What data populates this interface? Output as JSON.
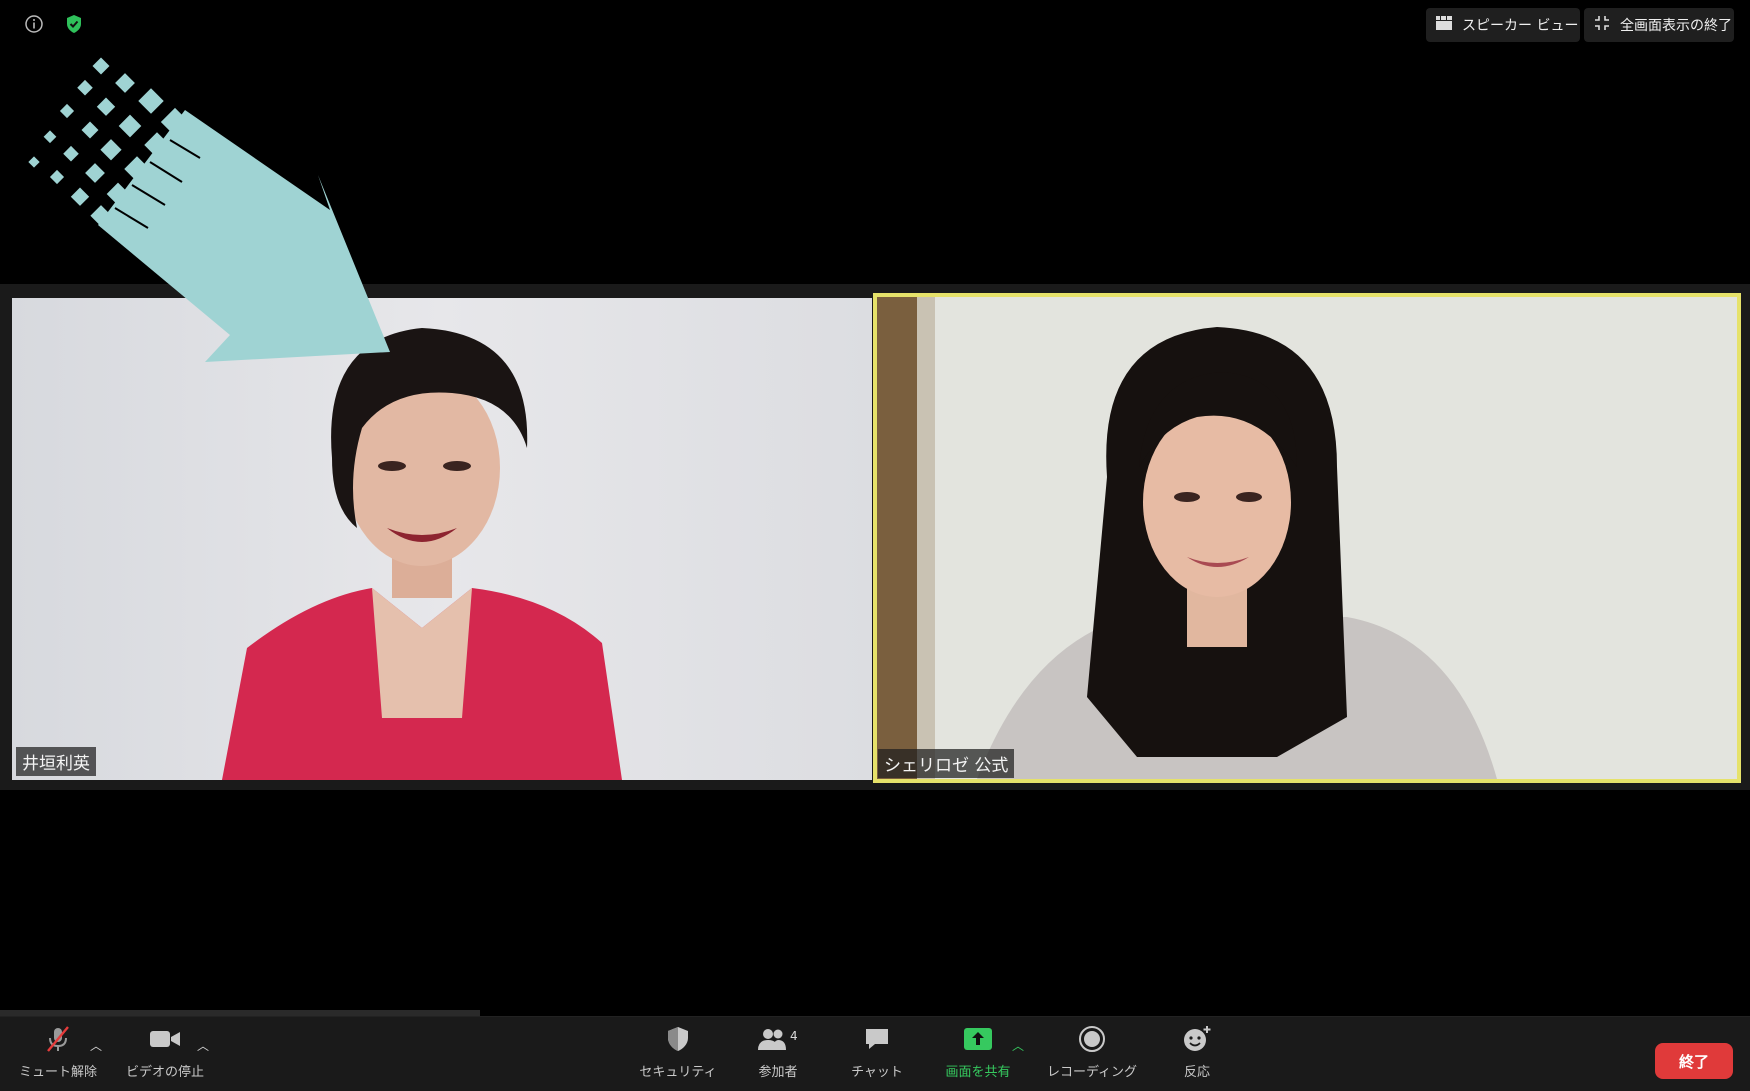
{
  "top_bar": {
    "speaker_view_label": "スピーカー ビュー",
    "exit_fullscreen_label": "全画面表示の終了"
  },
  "participants": [
    {
      "name": "井垣利英"
    },
    {
      "name": "シェリロゼ 公式"
    }
  ],
  "toolbar": {
    "mute_label": "ミュート解除",
    "video_label": "ビデオの停止",
    "security_label": "セキュリティ",
    "participants_label": "参加者",
    "participants_count": "4",
    "chat_label": "チャット",
    "share_label": "画面を共有",
    "record_label": "レコーディング",
    "reactions_label": "反応",
    "end_label": "終了"
  },
  "colors": {
    "background": "#000000",
    "active_speaker_border": "#e6e26a",
    "share_green": "#36c95f",
    "end_red": "#e03a3a",
    "arrow": "#9fd3d3"
  },
  "icons": [
    "info-icon",
    "shield-check-icon",
    "grid-icon",
    "shrink-icon",
    "mic-muted-icon",
    "camera-icon",
    "security-shield-icon",
    "people-icon",
    "chat-bubble-icon",
    "share-screen-icon",
    "record-icon",
    "reaction-icon"
  ]
}
